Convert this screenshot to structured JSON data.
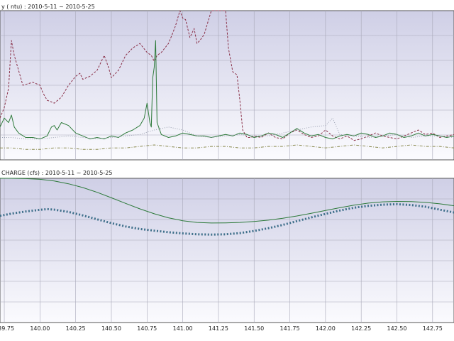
{
  "colors": {
    "plot_bg_top": "#cfcfe6",
    "plot_bg_bottom": "#fbfbfe",
    "grid": "#a8a8b8",
    "green": "#2d7a3a",
    "maroon": "#8a3048",
    "dotted_grey": "#9aa0b0",
    "olive": "#8a8a50",
    "blue_dotted": "#3e6f8a"
  },
  "chart_data": [
    {
      "type": "line",
      "title": "y ( ntu) : 2010-5-11 ~ 2010-5-25",
      "x_ticks": [
        140.0,
        140.25,
        140.5,
        140.75,
        141.0,
        141.25,
        141.5,
        141.75,
        142.0,
        142.25,
        142.5,
        142.75
      ],
      "xlim": [
        139.72,
        142.9
      ],
      "ylim": [
        0,
        100
      ],
      "grid": true,
      "series": [
        {
          "color_key": "maroon",
          "style": "dashed",
          "x": [
            139.72,
            139.75,
            139.78,
            139.8,
            139.82,
            139.85,
            139.88,
            139.95,
            140.0,
            140.02,
            140.05,
            140.1,
            140.15,
            140.2,
            140.25,
            140.28,
            140.3,
            140.35,
            140.4,
            140.45,
            140.48,
            140.5,
            140.55,
            140.6,
            140.65,
            140.7,
            140.75,
            140.78,
            140.8,
            140.82,
            140.85,
            140.9,
            140.93,
            140.95,
            140.98,
            141.0,
            141.02,
            141.05,
            141.08,
            141.1,
            141.12,
            141.15,
            141.2,
            141.25,
            141.28,
            141.3,
            141.32,
            141.35,
            141.38,
            141.4,
            141.42,
            141.45,
            141.48,
            141.5,
            141.55,
            141.6,
            141.65,
            141.7,
            141.75,
            141.8,
            141.85,
            141.9,
            141.95,
            142.0,
            142.05,
            142.1,
            142.15,
            142.2,
            142.25,
            142.3,
            142.35,
            142.4,
            142.45,
            142.5,
            142.55,
            142.6,
            142.65,
            142.7,
            142.75,
            142.8,
            142.85,
            142.9
          ],
          "values": [
            28,
            35,
            48,
            80,
            70,
            60,
            50,
            52,
            50,
            45,
            40,
            38,
            42,
            50,
            56,
            58,
            54,
            56,
            60,
            70,
            62,
            55,
            60,
            70,
            75,
            78,
            72,
            70,
            66,
            70,
            72,
            78,
            85,
            90,
            100,
            95,
            94,
            82,
            88,
            78,
            80,
            84,
            100,
            100,
            100,
            100,
            75,
            59,
            57,
            40,
            20,
            15,
            15,
            16,
            15,
            18,
            15,
            14,
            18,
            20,
            17,
            15,
            16,
            20,
            16,
            14,
            16,
            13,
            14,
            16,
            18,
            16,
            15,
            14,
            16,
            18,
            20,
            17,
            18,
            15,
            16,
            17
          ]
        },
        {
          "color_key": "green",
          "style": "solid",
          "x": [
            139.72,
            139.75,
            139.78,
            139.8,
            139.82,
            139.85,
            139.9,
            139.95,
            140.0,
            140.05,
            140.08,
            140.1,
            140.12,
            140.15,
            140.2,
            140.25,
            140.3,
            140.35,
            140.4,
            140.45,
            140.5,
            140.55,
            140.6,
            140.65,
            140.7,
            140.73,
            140.75,
            140.77,
            140.78,
            140.79,
            140.8,
            140.81,
            140.82,
            140.85,
            140.9,
            140.95,
            141.0,
            141.05,
            141.1,
            141.15,
            141.2,
            141.25,
            141.3,
            141.35,
            141.4,
            141.45,
            141.5,
            141.55,
            141.6,
            141.65,
            141.7,
            141.75,
            141.8,
            141.85,
            141.9,
            141.95,
            142.0,
            142.05,
            142.1,
            142.15,
            142.2,
            142.25,
            142.3,
            142.35,
            142.4,
            142.45,
            142.5,
            142.55,
            142.6,
            142.65,
            142.7,
            142.75,
            142.8,
            142.85,
            142.9
          ],
          "values": [
            22,
            28,
            25,
            30,
            22,
            18,
            15,
            15,
            14,
            16,
            22,
            23,
            20,
            25,
            23,
            18,
            16,
            14,
            15,
            14,
            16,
            15,
            18,
            20,
            23,
            28,
            38,
            25,
            22,
            55,
            62,
            80,
            25,
            17,
            15,
            16,
            18,
            17,
            16,
            16,
            15,
            16,
            17,
            16,
            18,
            17,
            15,
            16,
            18,
            17,
            15,
            18,
            21,
            18,
            16,
            17,
            15,
            14,
            16,
            17,
            16,
            18,
            17,
            15,
            16,
            18,
            17,
            15,
            16,
            18,
            16,
            17,
            16,
            15,
            16
          ]
        },
        {
          "color_key": "dotted_grey",
          "style": "dotted",
          "x": [
            139.72,
            139.8,
            139.9,
            140.0,
            140.1,
            140.2,
            140.3,
            140.4,
            140.5,
            140.6,
            140.7,
            140.8,
            140.9,
            141.0,
            141.1,
            141.2,
            141.3,
            141.4,
            141.5,
            141.6,
            141.7,
            141.8,
            141.9,
            142.0,
            142.05,
            142.1,
            142.2,
            142.3,
            142.4,
            142.5,
            142.6,
            142.7,
            142.8,
            142.9
          ],
          "values": [
            15,
            15,
            14,
            14,
            15,
            16,
            15,
            14,
            15,
            16,
            17,
            20,
            22,
            20,
            16,
            15,
            16,
            17,
            16,
            16,
            18,
            20,
            22,
            23,
            28,
            17,
            16,
            15,
            16,
            17,
            15,
            16,
            16,
            15
          ]
        },
        {
          "color_key": "olive",
          "style": "dashdot",
          "x": [
            139.72,
            139.8,
            139.9,
            140.0,
            140.1,
            140.2,
            140.3,
            140.4,
            140.5,
            140.6,
            140.7,
            140.8,
            140.9,
            141.0,
            141.1,
            141.2,
            141.3,
            141.4,
            141.5,
            141.6,
            141.7,
            141.8,
            141.9,
            142.0,
            142.1,
            142.2,
            142.3,
            142.4,
            142.5,
            142.6,
            142.7,
            142.8,
            142.9
          ],
          "values": [
            8,
            8,
            7,
            7,
            8,
            8,
            7,
            7,
            8,
            8,
            9,
            10,
            9,
            8,
            8,
            9,
            9,
            8,
            8,
            9,
            9,
            10,
            9,
            8,
            9,
            10,
            9,
            8,
            9,
            10,
            9,
            9,
            8
          ]
        }
      ]
    },
    {
      "type": "line",
      "title": "CHARGE (cfs) : 2010-5-11 ~ 2010-5-25",
      "x_ticks": [
        140.0,
        140.25,
        140.5,
        140.75,
        141.0,
        141.25,
        141.5,
        141.75,
        142.0,
        142.25,
        142.5,
        142.75
      ],
      "xlim": [
        139.72,
        142.9
      ],
      "ylim": [
        0,
        100
      ],
      "grid": true,
      "series": [
        {
          "color_key": "green",
          "style": "solid",
          "x": [
            139.72,
            139.8,
            139.9,
            140.0,
            140.1,
            140.2,
            140.3,
            140.4,
            140.5,
            140.6,
            140.7,
            140.8,
            140.9,
            141.0,
            141.1,
            141.2,
            141.3,
            141.4,
            141.5,
            141.6,
            141.7,
            141.8,
            141.9,
            142.0,
            142.1,
            142.2,
            142.3,
            142.4,
            142.5,
            142.6,
            142.7,
            142.8,
            142.9
          ],
          "values": [
            100,
            100,
            99.8,
            99.3,
            98.2,
            96.2,
            93.6,
            90.3,
            86.5,
            82.6,
            78.8,
            75.4,
            72.6,
            70.6,
            69.4,
            69.0,
            69.1,
            69.4,
            70.1,
            71.0,
            72.3,
            73.9,
            75.7,
            77.7,
            79.6,
            81.4,
            82.8,
            83.7,
            84.0,
            83.9,
            83.3,
            82.3,
            81.0
          ]
        },
        {
          "color_key": "blue_dotted",
          "style": "dotted-heavy",
          "x": [
            139.72,
            139.8,
            139.9,
            140.0,
            140.05,
            140.1,
            140.2,
            140.3,
            140.4,
            140.5,
            140.6,
            140.7,
            140.8,
            140.9,
            141.0,
            141.1,
            141.2,
            141.3,
            141.4,
            141.5,
            141.6,
            141.7,
            141.8,
            141.9,
            142.0,
            142.1,
            142.2,
            142.3,
            142.4,
            142.5,
            142.6,
            142.7,
            142.8,
            142.9
          ],
          "values": [
            74,
            75.5,
            77,
            78.2,
            78.6,
            78.3,
            76.7,
            74.3,
            71.6,
            68.9,
            66.6,
            64.9,
            63.7,
            62.6,
            61.8,
            61.2,
            61.0,
            61.2,
            62.0,
            63.5,
            65.4,
            67.7,
            70.3,
            72.9,
            75.3,
            77.7,
            79.6,
            80.9,
            81.7,
            82.0,
            81.5,
            80.3,
            78.3,
            76.3
          ]
        }
      ]
    }
  ]
}
